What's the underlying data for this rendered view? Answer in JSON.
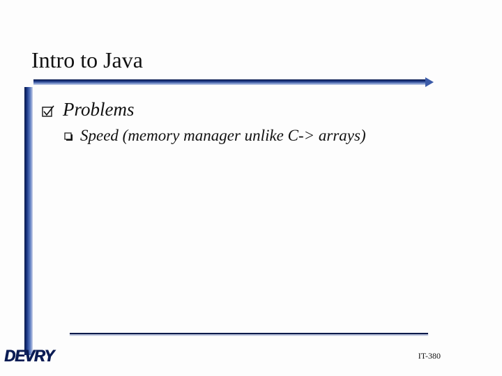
{
  "slide": {
    "title": "Intro to Java",
    "bullets": {
      "lvl1": {
        "text": "Problems"
      },
      "lvl2": {
        "text": "Speed (memory manager unlike C-> arrays)"
      }
    }
  },
  "footer": {
    "logo": "DEVRY",
    "page": "IT-380"
  },
  "colors": {
    "brand_dark": "#0a1a4a",
    "brand_mid": "#3a5aa8",
    "brand_light": "#cfd7eb"
  }
}
